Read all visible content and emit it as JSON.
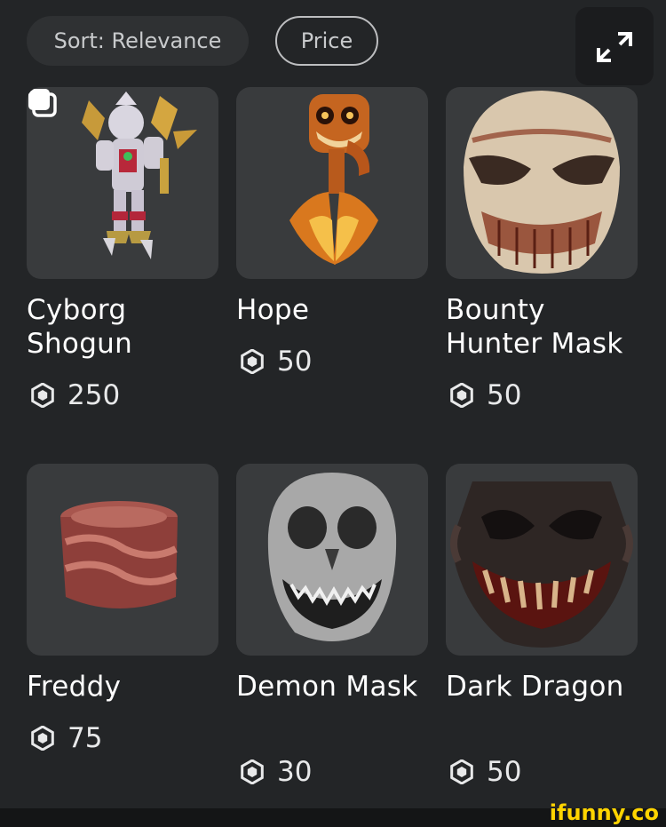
{
  "top_bar": {
    "sort_label": "Sort: Relevance",
    "price_label": "Price",
    "expand_icon": "expand-arrows-icon"
  },
  "items": [
    {
      "name": "Cyborg Shogun",
      "price": "250",
      "bundle": true,
      "thumb_icon": "cyborg-shogun-figure"
    },
    {
      "name": "Hope",
      "price": "50",
      "bundle": false,
      "thumb_icon": "hope-mask"
    },
    {
      "name": "Bounty Hunter Mask",
      "price": "50",
      "bundle": false,
      "thumb_icon": "bounty-hunter-mask"
    },
    {
      "name": "Freddy",
      "price": "75",
      "bundle": false,
      "thumb_icon": "freddy-hat"
    },
    {
      "name": "Demon Mask",
      "price": "30",
      "bundle": false,
      "thumb_icon": "demon-mask"
    },
    {
      "name": "Dark Dragon",
      "price": "50",
      "bundle": false,
      "thumb_icon": "dark-dragon-mask"
    }
  ],
  "currency_icon": "robux-icon",
  "watermark": "ifunny.co",
  "colors": {
    "background": "#232527",
    "card": "#393b3d",
    "text": "#ffffff",
    "watermark": "#ffd400"
  }
}
